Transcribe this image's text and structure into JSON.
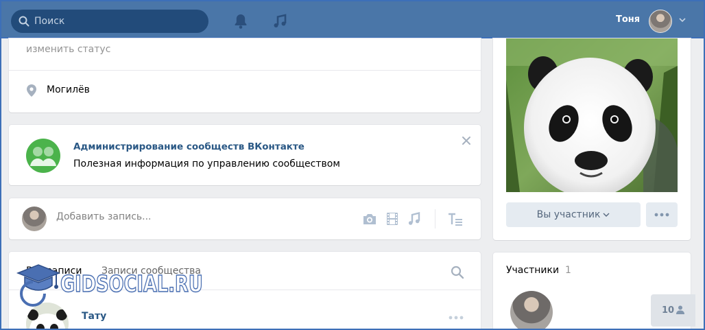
{
  "header": {
    "search_placeholder": "Поиск",
    "user_name": "Тоня",
    "icons": [
      "search-icon",
      "bell-icon",
      "music-icon",
      "chevron-down-icon"
    ]
  },
  "profile": {
    "status_link": "изменить статус",
    "city": "Могилёв"
  },
  "promo": {
    "title": "Администрирование сообществ ВКонтакте",
    "description": "Полезная информация по управлению сообществом"
  },
  "composer": {
    "placeholder": "Добавить запись...",
    "attachments": [
      "camera-icon",
      "video-icon",
      "music-icon",
      "text-format-icon"
    ]
  },
  "feed": {
    "tabs": [
      {
        "label": "Все записи"
      },
      {
        "label": "Записи сообщества"
      }
    ],
    "post_author": "Тату"
  },
  "community": {
    "member_button": "Вы участник",
    "members_label": "Участники",
    "members_count": "1",
    "online_count": "10"
  },
  "watermark": {
    "text": "GIDSOCIAL.RU"
  },
  "colors": {
    "header": "#4a76a8",
    "link": "#2a5885",
    "accent_green": "#4bb34b",
    "button_bg": "#e5ebf1"
  }
}
